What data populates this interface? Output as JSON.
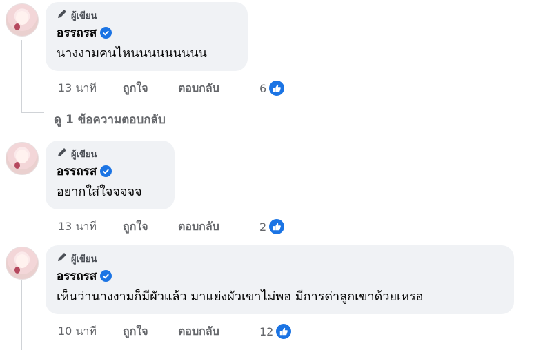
{
  "comments": [
    {
      "author_badge": "ผู้เขียน",
      "author": "อรรถรส",
      "text": "นางงามคนไหนนนนนนนนน",
      "time": "13 นาที",
      "like_label": "ถูกใจ",
      "reply_label": "ตอบกลับ",
      "reaction_count": "6"
    },
    {
      "author_badge": "ผู้เขียน",
      "author": "อรรถรส",
      "text": "อยากใส่ใจจจจจ",
      "time": "13 นาที",
      "like_label": "ถูกใจ",
      "reply_label": "ตอบกลับ",
      "reaction_count": "2"
    },
    {
      "author_badge": "ผู้เขียน",
      "author": "อรรถรส",
      "text": "เห็นว่านางงามก็มีผัวแล้ว มาแย่งผัวเขาไม่พอ มีการด่าลูกเขาด้วยเหรอ",
      "time": "10 นาที",
      "like_label": "ถูกใจ",
      "reply_label": "ตอบกลับ",
      "reaction_count": "12"
    }
  ],
  "view_replies_label": "ดู 1 ข้อความตอบกลับ",
  "icons": {
    "badge": "pencil-icon",
    "verified": "verified-badge-icon",
    "reaction": "like-thumb-icon"
  },
  "colors": {
    "accent": "#1b74e4",
    "bubble": "#f0f2f5",
    "secondary_text": "#65676b"
  }
}
